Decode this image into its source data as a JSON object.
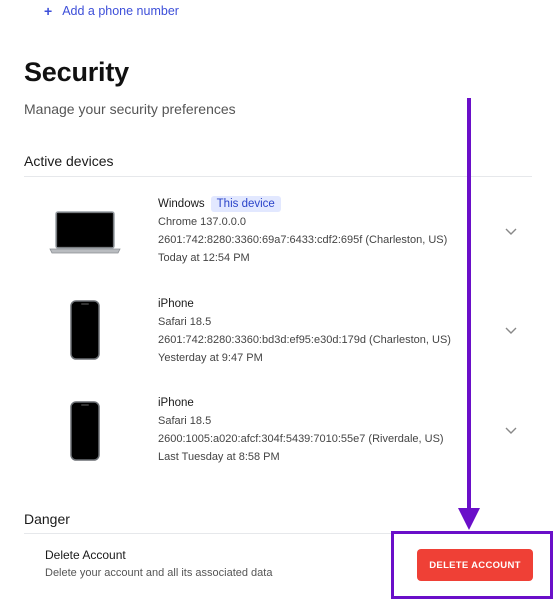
{
  "phone": {
    "add_label": "Add a phone number",
    "icon": "plus-icon"
  },
  "header": {
    "title": "Security",
    "subtitle": "Manage your security preferences"
  },
  "active_devices": {
    "heading": "Active devices",
    "devices": [
      {
        "name": "Windows",
        "badge": "This device",
        "browser": "Chrome 137.0.0.0",
        "ip_location": "2601:742:8280:3360:69a7:6433:cdf2:695f (Charleston, US)",
        "last_seen": "Today at 12:54 PM",
        "icon": "laptop-icon"
      },
      {
        "name": "iPhone",
        "browser": "Safari 18.5",
        "ip_location": "2601:742:8280:3360:bd3d:ef95:e30d:179d (Charleston, US)",
        "last_seen": "Yesterday at 9:47 PM",
        "icon": "phone-icon"
      },
      {
        "name": "iPhone",
        "browser": "Safari 18.5",
        "ip_location": "2600:1005:a020:afcf:304f:5439:7010:55e7 (Riverdale, US)",
        "last_seen": "Last Tuesday at 8:58 PM",
        "icon": "phone-icon"
      }
    ]
  },
  "danger": {
    "heading": "Danger",
    "delete_title": "Delete Account",
    "delete_description": "Delete your account and all its associated data",
    "delete_button_label": "DELETE ACCOUNT"
  },
  "colors": {
    "link": "#3d4fd9",
    "badge_bg": "#e2e8ff",
    "danger_button": "#ef4036",
    "annotation": "#6a0fc9"
  }
}
